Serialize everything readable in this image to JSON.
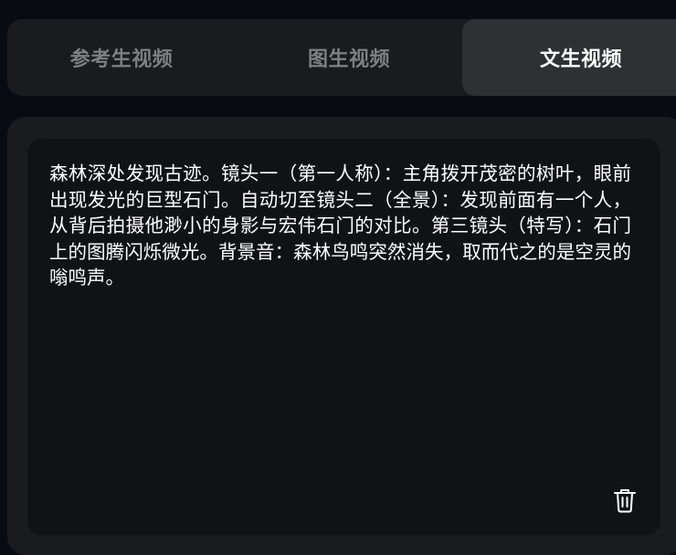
{
  "tabs": [
    {
      "label": "参考生视频",
      "active": false
    },
    {
      "label": "图生视频",
      "active": false
    },
    {
      "label": "文生视频",
      "active": true
    }
  ],
  "prompt": {
    "text": "森林深处发现古迹。镜头一（第一人称）：主角拨开茂密的树叶，眼前出现发光的巨型石门。自动切至镜头二（全景）：发现前面有一个人，从背后拍摄他渺小的身影与宏伟石门的对比。第三镜头（特写）：石门上的图腾闪烁微光。背景音：森林鸟鸣突然消失，取而代之的是空灵的嗡鸣声。"
  },
  "icons": {
    "delete": "trash-icon"
  },
  "colors": {
    "background": "#080c12",
    "panel": "#1a1b1f",
    "editor": "#111214",
    "active_tab": "#2f3034",
    "inactive_tab_text": "#7e7f84",
    "text": "#ffffff"
  }
}
